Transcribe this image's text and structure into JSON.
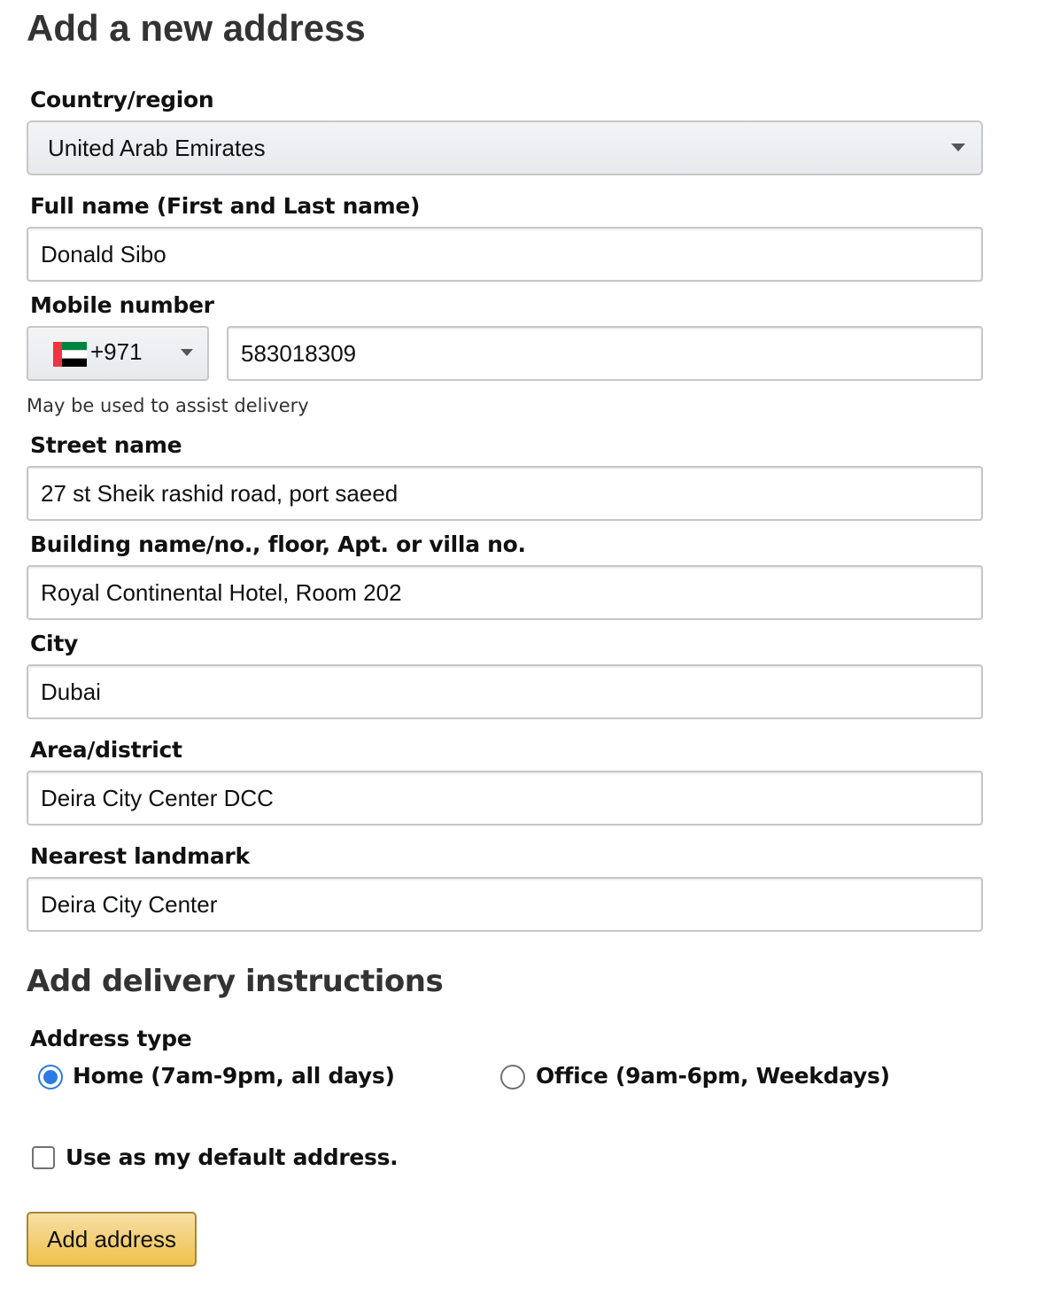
{
  "page_title": "Add a new address",
  "country": {
    "label": "Country/region",
    "value": "United Arab Emirates"
  },
  "full_name": {
    "label": "Full name (First and Last name)",
    "value": "Donald Sibo"
  },
  "mobile": {
    "label": "Mobile number",
    "country_code": "+971",
    "flag_icon": "uae-flag-icon",
    "value": "583018309",
    "helper": "May be used to assist delivery"
  },
  "street": {
    "label": "Street name",
    "value": "27 st Sheik rashid road, port saeed"
  },
  "building": {
    "label": "Building name/no., floor, Apt. or villa no.",
    "value": "Royal Continental Hotel, Room 202"
  },
  "city": {
    "label": "City",
    "value": "Dubai"
  },
  "area": {
    "label": "Area/district",
    "value": "Deira City Center DCC"
  },
  "landmark": {
    "label": "Nearest landmark",
    "value": "Deira City Center"
  },
  "delivery": {
    "title": "Add delivery instructions",
    "address_type_label": "Address type",
    "options": [
      {
        "label": "Home (7am-9pm, all days)",
        "selected": true
      },
      {
        "label": "Office (9am-6pm, Weekdays)",
        "selected": false
      }
    ]
  },
  "default_address": {
    "label": "Use as my default address.",
    "checked": false
  },
  "submit_label": "Add address",
  "colors": {
    "radio_selected": "#2c7be5",
    "button_top": "#f7dfa5",
    "button_bottom": "#f0c14b",
    "button_border": "#a88734"
  }
}
